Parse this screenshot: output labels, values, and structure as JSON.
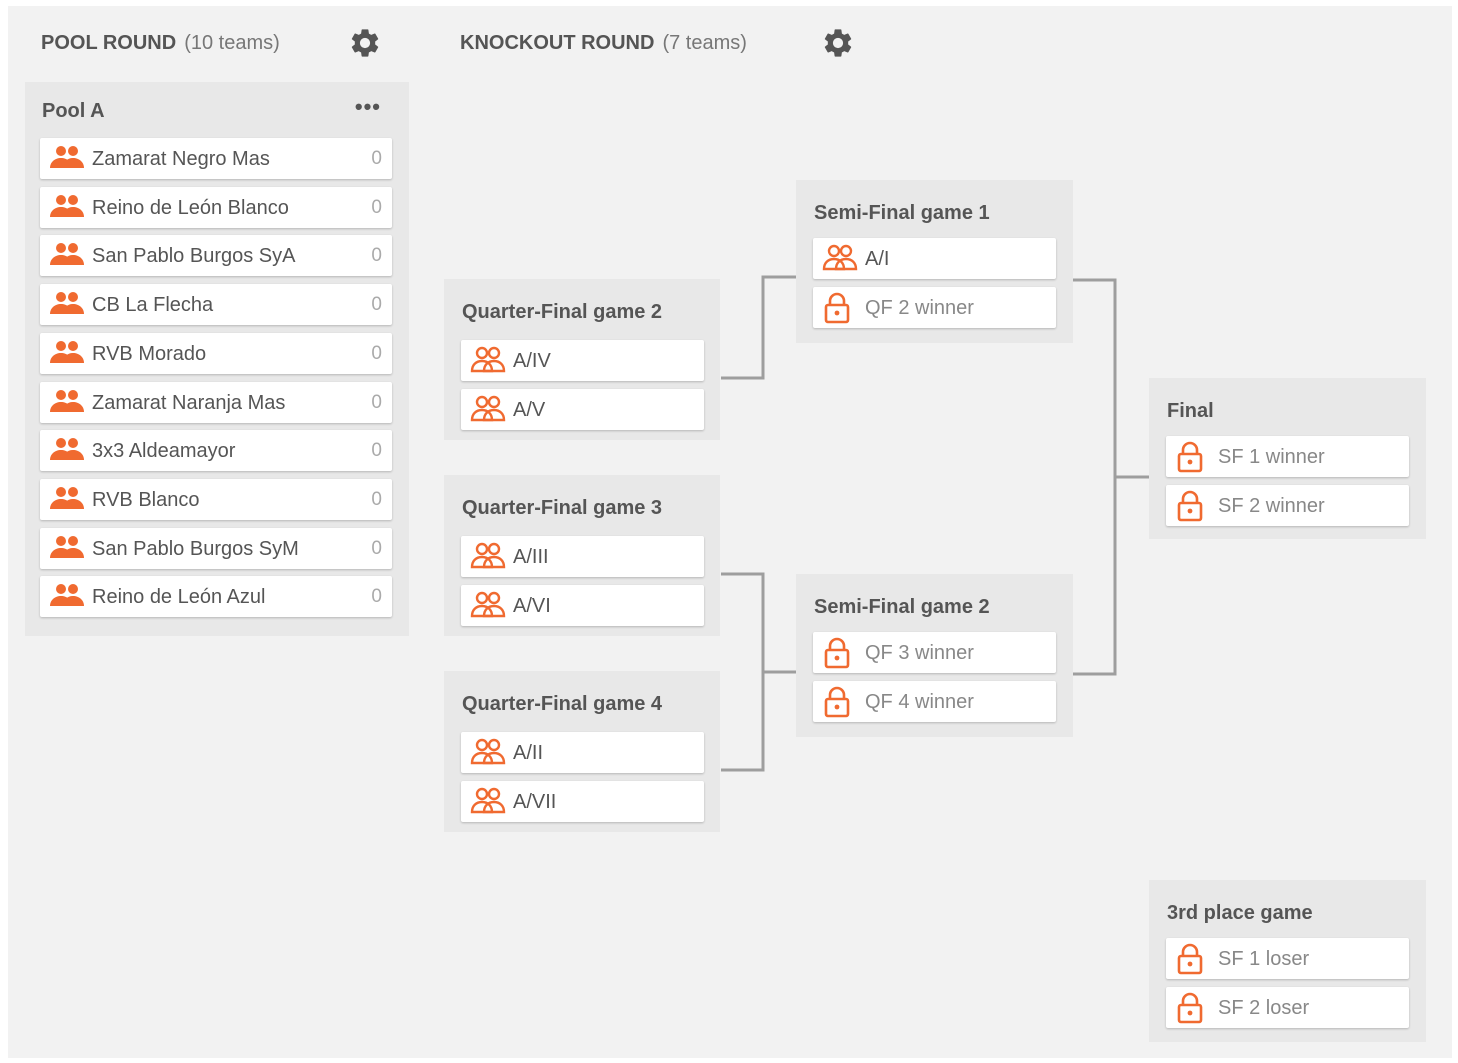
{
  "colors": {
    "accent": "#f06a30",
    "background": "#f2f2f2",
    "panel": "#e8e8e8",
    "connector": "#9e9e9e"
  },
  "pool_round": {
    "title": "POOL ROUND",
    "count": "(10 teams)",
    "settings_icon": "gear-icon"
  },
  "knockout_round": {
    "title": "KNOCKOUT ROUND",
    "count": "(7 teams)",
    "settings_icon": "gear-icon"
  },
  "pool": {
    "name": "Pool A",
    "menu": "•••",
    "teams": [
      {
        "name": "Zamarat Negro Mas",
        "score": "0"
      },
      {
        "name": "Reino de León Blanco",
        "score": "0"
      },
      {
        "name": "San Pablo Burgos SyA",
        "score": "0"
      },
      {
        "name": "CB La Flecha",
        "score": "0"
      },
      {
        "name": "RVB Morado",
        "score": "0"
      },
      {
        "name": "Zamarat Naranja Mas",
        "score": "0"
      },
      {
        "name": "3x3 Aldeamayor",
        "score": "0"
      },
      {
        "name": "RVB Blanco",
        "score": "0"
      },
      {
        "name": "San Pablo Burgos SyM",
        "score": "0"
      },
      {
        "name": "Reino de León Azul",
        "score": "0"
      }
    ]
  },
  "games": {
    "qf2": {
      "title": "Quarter-Final game 2",
      "slots": [
        "A/IV",
        "A/V"
      ]
    },
    "qf3": {
      "title": "Quarter-Final game 3",
      "slots": [
        "A/III",
        "A/VI"
      ]
    },
    "qf4": {
      "title": "Quarter-Final game 4",
      "slots": [
        "A/II",
        "A/VII"
      ]
    },
    "sf1": {
      "title": "Semi-Final game 1",
      "slots": [
        "A/I",
        "QF 2 winner"
      ]
    },
    "sf2": {
      "title": "Semi-Final game 2",
      "slots": [
        "QF 3 winner",
        "QF 4 winner"
      ]
    },
    "final": {
      "title": "Final",
      "slots": [
        "SF 1 winner",
        "SF 2 winner"
      ]
    },
    "third": {
      "title": "3rd place game",
      "slots": [
        "SF 1 loser",
        "SF 2 loser"
      ]
    }
  }
}
